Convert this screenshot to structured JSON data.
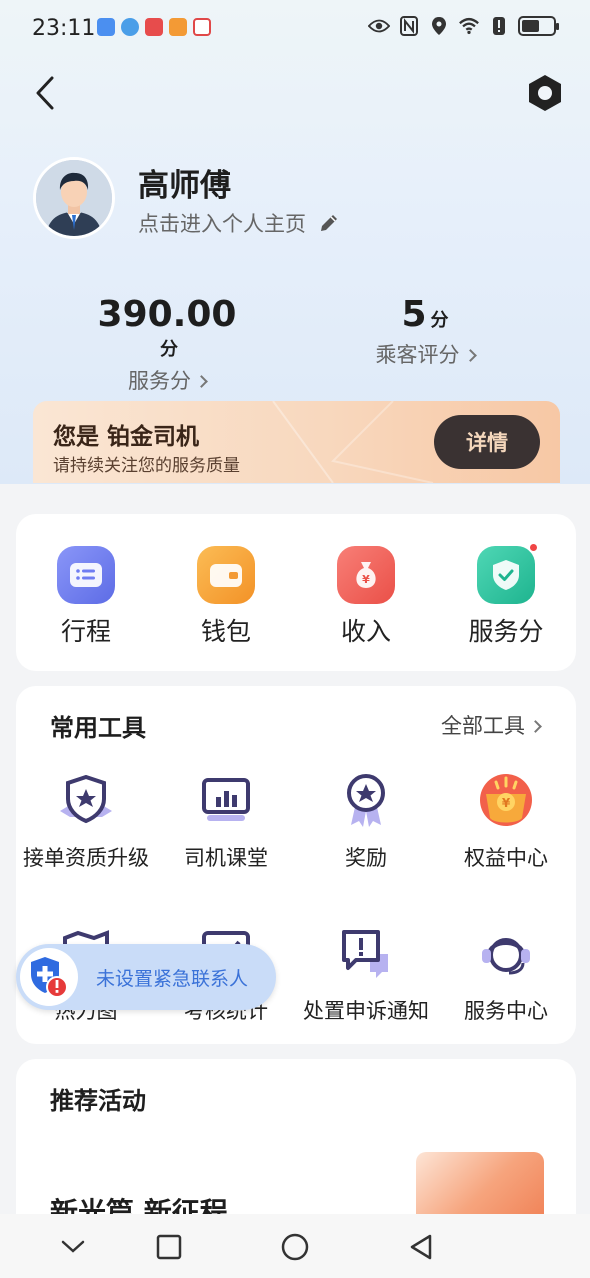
{
  "status_bar": {
    "time": "23:11",
    "app_icons": [
      "puzzle-icon",
      "browser-icon",
      "red-app-icon",
      "orange-app-icon",
      "calendar-icon"
    ],
    "right_icons": [
      "eye-icon",
      "nfc-icon",
      "location-icon",
      "wifi-icon",
      "alert-icon",
      "battery-icon"
    ],
    "battery_level": 0.55
  },
  "header": {
    "back_icon": "chevron-left-icon",
    "settings_icon": "hexagon-settings-icon"
  },
  "profile": {
    "name": "高师傅",
    "link_text": "点击进入个人主页",
    "edit_icon": "pencil-icon"
  },
  "stats": {
    "service_score": {
      "value": "390.00",
      "unit": "分",
      "label": "服务分"
    },
    "rating": {
      "value": "5",
      "unit": "分",
      "label": "乘客评分"
    }
  },
  "level_banner": {
    "title": "您是 铂金司机",
    "subtitle": "请持续关注您的服务质量",
    "button": "详情"
  },
  "quick_actions": [
    {
      "label": "行程",
      "icon": "trip-list-icon",
      "color": "#6f7df2"
    },
    {
      "label": "钱包",
      "icon": "wallet-icon",
      "color": "#f6a13b"
    },
    {
      "label": "收入",
      "icon": "money-bag-icon",
      "color": "#f0605d"
    },
    {
      "label": "服务分",
      "icon": "shield-check-icon",
      "color": "#2fc3a0",
      "badge": true
    }
  ],
  "tools": {
    "title": "常用工具",
    "all_link": "全部工具",
    "items": [
      {
        "label": "接单资质升级",
        "icon": "shield-star-icon"
      },
      {
        "label": "司机课堂",
        "icon": "chart-board-icon"
      },
      {
        "label": "奖励",
        "icon": "medal-icon"
      },
      {
        "label": "权益中心",
        "icon": "gift-coin-icon"
      },
      {
        "label": "热力图",
        "icon": "map-icon"
      },
      {
        "label": "考核统计",
        "icon": "trend-chart-icon"
      },
      {
        "label": "处置申诉通知",
        "icon": "appeal-message-icon"
      },
      {
        "label": "服务中心",
        "icon": "headset-icon"
      }
    ]
  },
  "activities": {
    "title": "推荐活动",
    "promo_text": "新光篇 新征程"
  },
  "emergency": {
    "text": "未设置紧急联系人",
    "icon": "shield-plus-alert-icon"
  },
  "nav_bar": [
    "chevron-down-icon",
    "square-icon",
    "circle-icon",
    "triangle-back-icon"
  ],
  "colors": {
    "primary_icon": "#3e3a6e",
    "accent_blue": "#3a72d8",
    "banner_dark": "#3a3232"
  }
}
